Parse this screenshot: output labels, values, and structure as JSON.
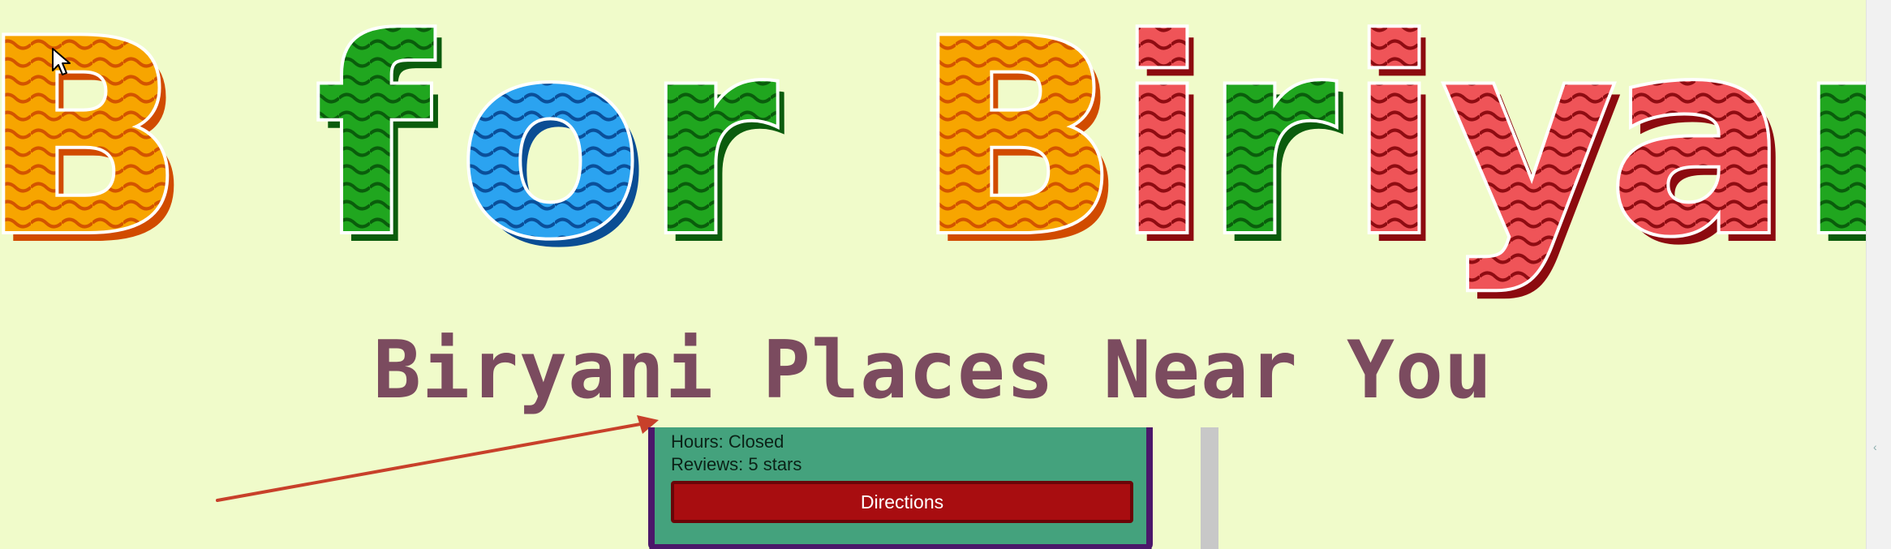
{
  "banner": {
    "words": [
      {
        "letters": [
          "B"
        ],
        "colors": [
          "orange"
        ]
      },
      {
        "letters": [
          "f",
          "o",
          "r"
        ],
        "colors": [
          "green",
          "blue",
          "green"
        ]
      },
      {
        "letters": [
          "B",
          "i",
          "r",
          "i",
          "y",
          "a",
          "n"
        ],
        "colors": [
          "orange",
          "red",
          "green",
          "red",
          "red",
          "red",
          "green"
        ]
      }
    ],
    "palette": {
      "orange": "#ff8a00",
      "green": "#1b8a17",
      "blue": "#1e88e5",
      "red": "#e02a2d"
    }
  },
  "heading": "Biryani Places Near You",
  "listing": {
    "hours": "Hours: Closed",
    "reviews": "Reviews: 5 stars",
    "directions_label": "Directions"
  },
  "colors": {
    "background": "#f0fbca",
    "heading": "#7b4b5f",
    "card_fill": "#44a27d",
    "card_border": "#4b176a",
    "button": "#a80d10",
    "annotation_arrow": "#c8402a"
  },
  "icons": {
    "cursor": "arrow-cursor-icon",
    "annotation": "red-arrow-icon"
  }
}
